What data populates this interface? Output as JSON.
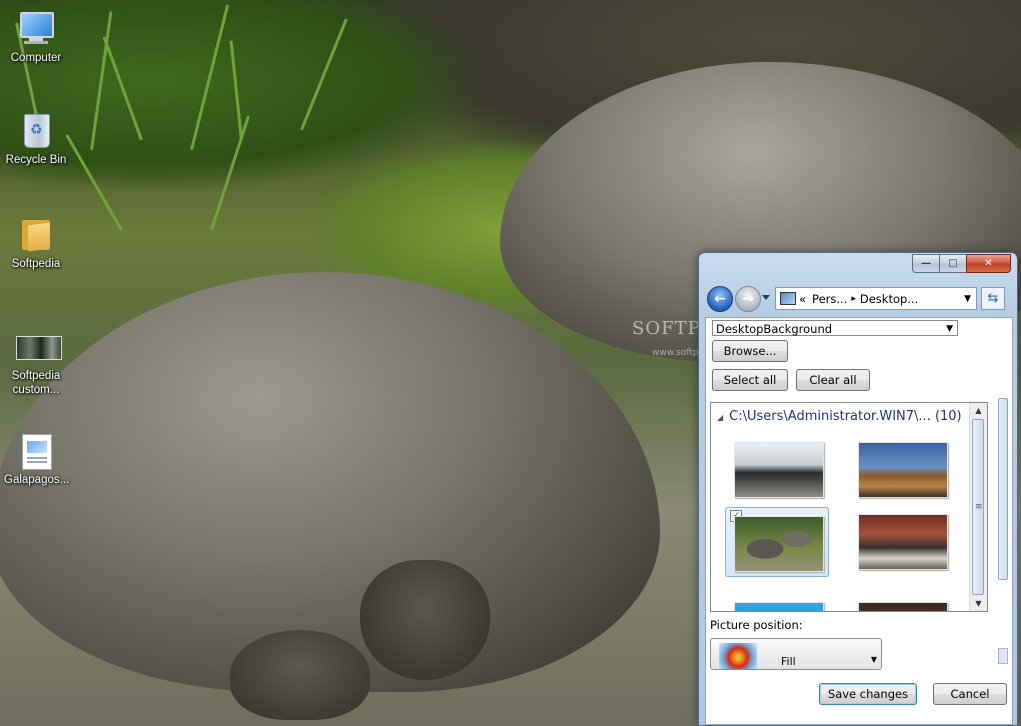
{
  "desktop": {
    "icons": [
      {
        "label": "Computer",
        "icon": "computer-icon"
      },
      {
        "label": "Recycle Bin",
        "icon": "recycle-bin-icon"
      },
      {
        "label": "Softpedia",
        "icon": "folder-icon"
      },
      {
        "label": "Softpedia custom...",
        "icon": "theme-thumbnail-icon"
      },
      {
        "label": "Galapagos...",
        "icon": "theme-pack-icon"
      }
    ],
    "wallpaper": "Giant tortoises in a pond"
  },
  "watermark": {
    "text": "SOFTPEDIA",
    "url": "www.softpedia.com"
  },
  "window": {
    "caption_buttons": {
      "minimize": "—",
      "maximize": "□",
      "close": "✕"
    },
    "address": {
      "prefix": "«",
      "crumb1": "Pers...",
      "separator": "▸",
      "crumb2": "Desktop..."
    },
    "folder_dropdown": "DesktopBackground",
    "browse_label": "Browse...",
    "select_all_label": "Select all",
    "clear_all_label": "Clear all",
    "group": {
      "path": "C:\\Users\\Administrator.WIN7\\...",
      "count": "(10)"
    },
    "pictures": [
      {
        "name": "marine-iguana",
        "selected": false
      },
      {
        "name": "blue-footed-booby",
        "selected": false
      },
      {
        "name": "tortoises",
        "selected": true
      },
      {
        "name": "birds-on-rock",
        "selected": false
      },
      {
        "name": "sea",
        "selected": false
      },
      {
        "name": "rock",
        "selected": false
      }
    ],
    "picture_position_label": "Picture position:",
    "picture_position_value": "Fill",
    "save_label": "Save changes",
    "cancel_label": "Cancel"
  },
  "colors": {
    "window_frame": "#b7cde4",
    "link_text": "#1e3287",
    "selection": "#d5e7fb"
  }
}
